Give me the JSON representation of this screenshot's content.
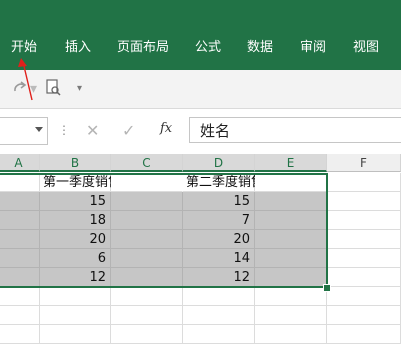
{
  "ribbon": {
    "accent_color": "#217346",
    "tabs": [
      "开始",
      "插入",
      "页面布局",
      "公式",
      "数据",
      "审阅",
      "视图"
    ]
  },
  "qat": {
    "icons": [
      "redo-icon",
      "print-preview-icon",
      "customize-toolbar-icon"
    ]
  },
  "formula_bar": {
    "name_box_value": "",
    "cancel_icon": "close-icon",
    "enter_icon": "checkmark-icon",
    "function_label": "fx",
    "content": "姓名"
  },
  "sheet": {
    "columns": [
      "A",
      "B",
      "C",
      "D",
      "E",
      "F"
    ],
    "header_b": "第一季度销售量",
    "header_d": "第二季度销售量",
    "rows": [
      {
        "b": "15",
        "d": "15"
      },
      {
        "b": "18",
        "d": "7"
      },
      {
        "b": "20",
        "d": "20"
      },
      {
        "b": "6",
        "d": "14"
      },
      {
        "b": "12",
        "d": "12"
      }
    ],
    "selection_color": "#c6c6c6"
  }
}
